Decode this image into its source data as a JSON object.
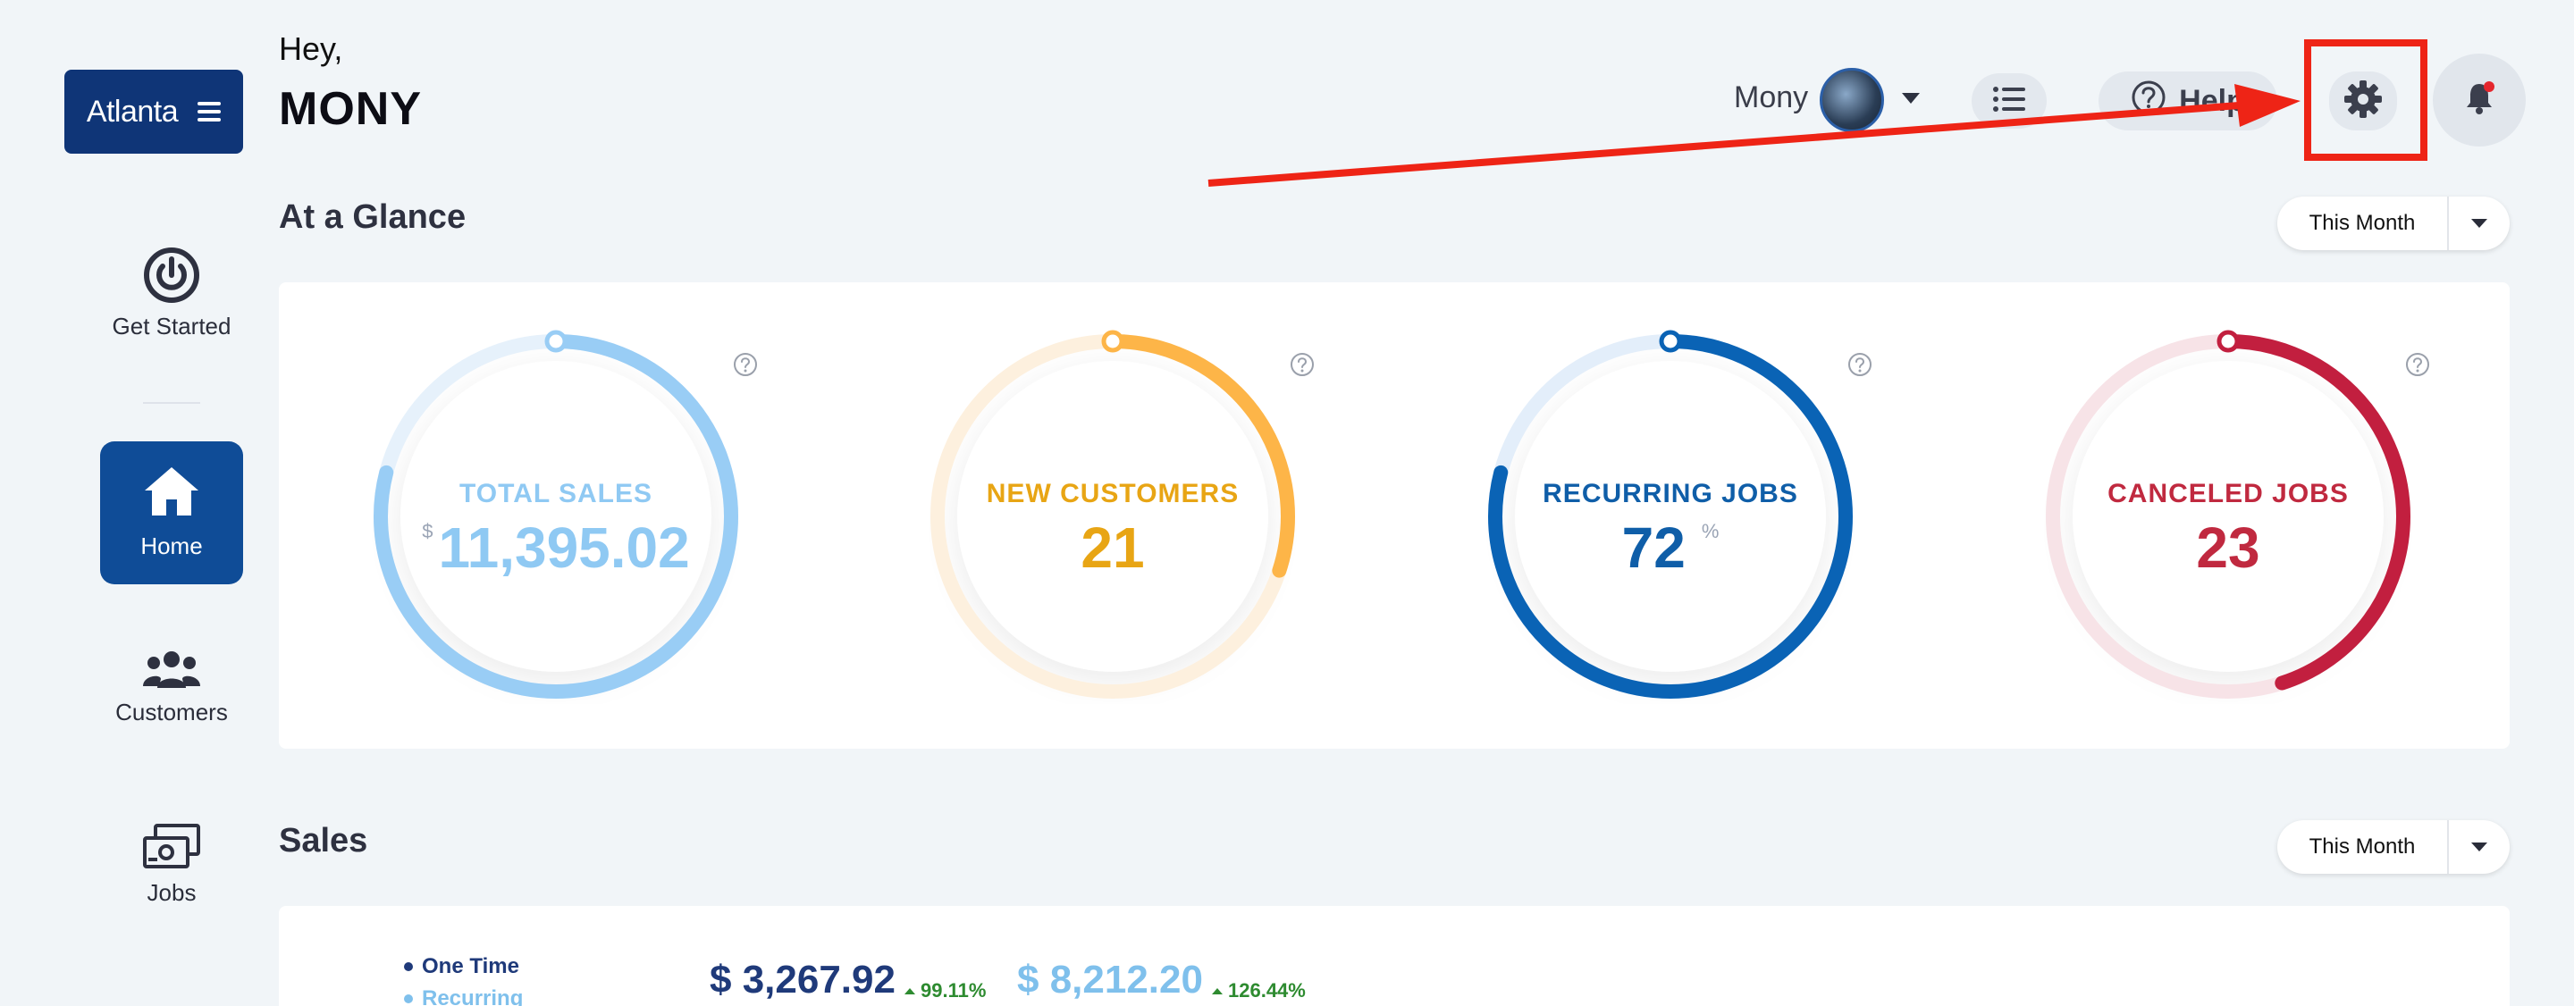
{
  "brand": {
    "label": "Atlanta"
  },
  "sidebar": {
    "items": [
      {
        "label": "Get Started",
        "icon": "power-icon"
      },
      {
        "label": "Home",
        "icon": "home-icon",
        "active": true
      },
      {
        "label": "Customers",
        "icon": "users-icon"
      },
      {
        "label": "Jobs",
        "icon": "jobs-icon"
      }
    ]
  },
  "header": {
    "greeting": "Hey,",
    "username": "MONY",
    "user_display": "Mony",
    "help_label": "Help"
  },
  "glance": {
    "title": "At a Glance",
    "period": "This Month",
    "kpis": [
      {
        "label": "TOTAL SALES",
        "prefix": "$",
        "value": "11,395.02",
        "suffix": "",
        "color": "#99cdf5",
        "track": "#e6f1fb",
        "progress": 0.79,
        "text_color": "#8fc9f3"
      },
      {
        "label": "NEW CUSTOMERS",
        "prefix": "",
        "value": "21",
        "suffix": "",
        "color": "#fdb548",
        "track": "#fdf0de",
        "progress": 0.3,
        "text_color": "#e8a514"
      },
      {
        "label": "RECURRING JOBS",
        "prefix": "",
        "value": "72",
        "suffix": "%",
        "color": "#0a63b5",
        "track": "#e3eefa",
        "progress": 0.79,
        "text_color": "#0f5ea8"
      },
      {
        "label": "CANCELED JOBS",
        "prefix": "",
        "value": "23",
        "suffix": "",
        "color": "#c21f3f",
        "track": "#f7e3e7",
        "progress": 0.45,
        "text_color": "#c0293f"
      }
    ]
  },
  "sales": {
    "title": "Sales",
    "period": "This Month",
    "legend": [
      {
        "label": "One Time",
        "color": "#1f3a7a"
      },
      {
        "label": "Recurring",
        "color": "#7fc0ec"
      }
    ],
    "one_time": {
      "value": "$ 3,267.92",
      "change": "99.11%"
    },
    "recurring": {
      "value": "$ 8,212.20",
      "change": "126.44%"
    }
  }
}
